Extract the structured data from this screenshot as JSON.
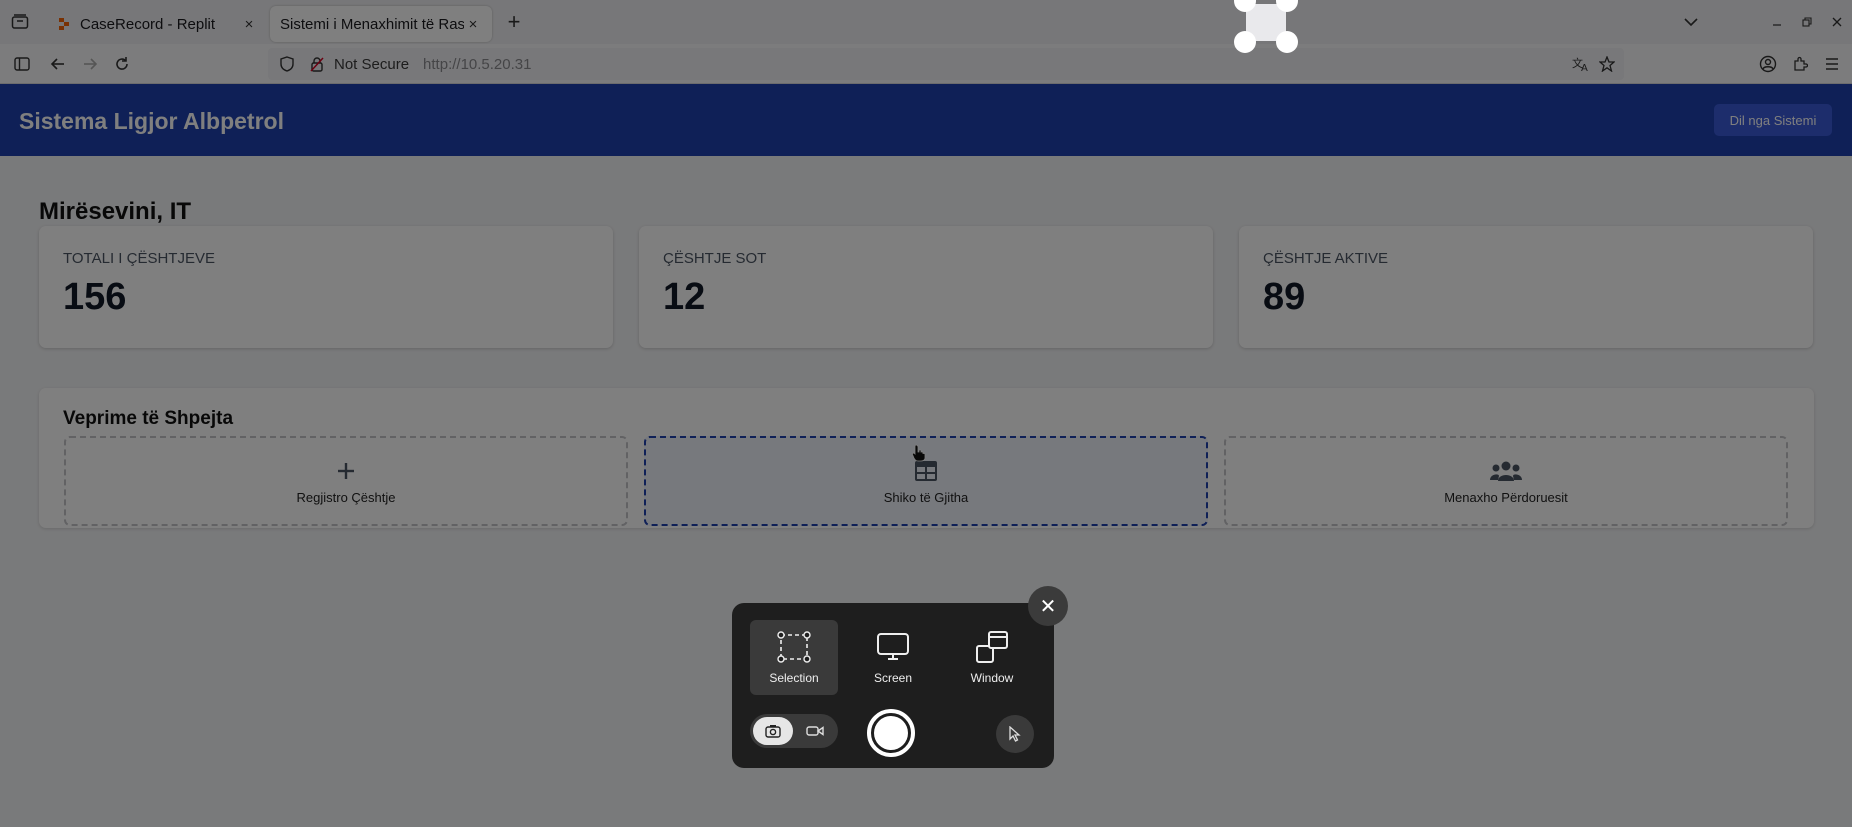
{
  "browser": {
    "tabs": [
      {
        "title": "CaseRecord - Replit",
        "active": false
      },
      {
        "title": "Sistemi i Menaxhimit të Rast",
        "active": true
      }
    ],
    "address": {
      "security_text": "Not Secure",
      "url": "http://10.5.20.31"
    },
    "icons": {
      "tab_list": "tab-list-icon",
      "new_tab": "+",
      "close_tab": "×"
    }
  },
  "app": {
    "title": "Sistema Ligjor Albpetrol",
    "logout_label": "Dil nga Sistemi",
    "header_color": "#1e40af",
    "welcome": "Mirësevini, IT",
    "stats": [
      {
        "label": "TOTALI I ÇËSHTJEVE",
        "value": "156"
      },
      {
        "label": "ÇËSHTJE SOT",
        "value": "12"
      },
      {
        "label": "ÇËSHTJE AKTIVE",
        "value": "89"
      }
    ],
    "quick_actions": {
      "title": "Veprime të Shpejta",
      "items": [
        {
          "label": "Regjistro Çështje",
          "icon": "plus-icon"
        },
        {
          "label": "Shiko të Gjitha",
          "icon": "table-icon"
        },
        {
          "label": "Menaxho Përdoruesit",
          "icon": "users-icon"
        }
      ]
    }
  },
  "screenshot_tool": {
    "modes": [
      {
        "label": "Selection",
        "icon": "selection-icon",
        "selected": true
      },
      {
        "label": "Screen",
        "icon": "monitor-icon",
        "selected": false
      },
      {
        "label": "Window",
        "icon": "window-icon",
        "selected": false
      }
    ],
    "capture_type": "screenshot",
    "close_label": "✕"
  }
}
